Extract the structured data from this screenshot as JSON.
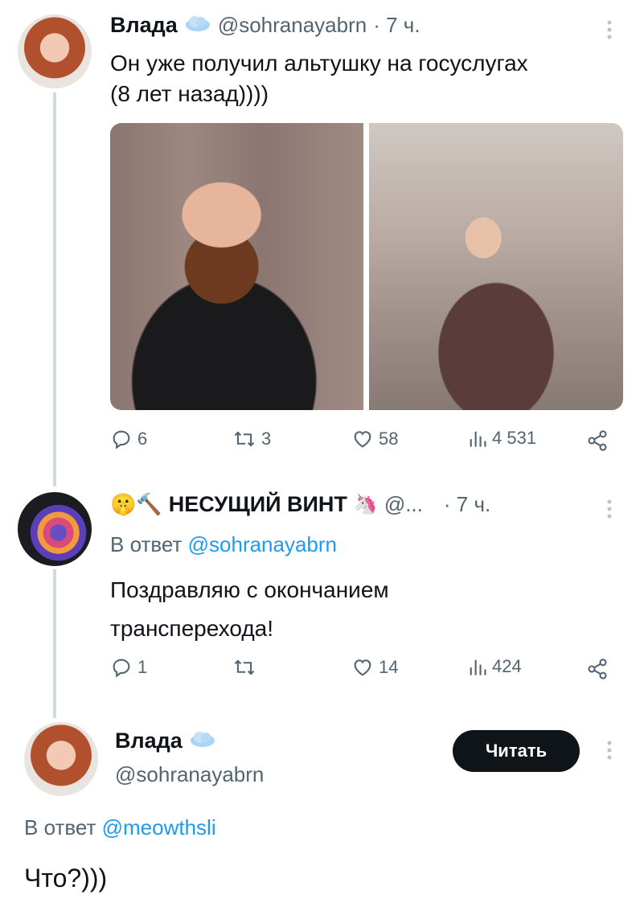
{
  "tweet1": {
    "name": "Влада",
    "handle": "@sohranayabrn",
    "time": "· 7 ч.",
    "text_line1": "Он уже получил альтушку на госуслугах",
    "text_line2": "(8 лет назад))))",
    "actions": {
      "replies": "6",
      "retweets": "3",
      "likes": "58",
      "views": "4 531"
    }
  },
  "tweet2": {
    "name": "НЕСУЩИЙ ВИНТ",
    "name_emoji_prefix": "🤫🔨",
    "name_emoji_suffix": "🦄",
    "handle": "@...",
    "time": "· 7 ч.",
    "reply_prefix": "В ответ",
    "reply_handle": "@sohranayabrn",
    "text_line1": "Поздравляю с окончанием",
    "text_line2": "трансперехода!",
    "actions": {
      "replies": "1",
      "retweets": "",
      "likes": "14",
      "views": "424"
    }
  },
  "tweet3": {
    "name": "Влада",
    "handle": "@sohranayabrn",
    "follow_label": "Читать",
    "reply_prefix": "В ответ",
    "reply_handle": "@meowthsli",
    "text": "Что?)))"
  },
  "icons": {
    "verified": "cloud-badge-icon",
    "more": "more-vertical-icon",
    "reply": "reply-icon",
    "retweet": "retweet-icon",
    "like": "heart-icon",
    "views": "views-icon",
    "share": "share-icon"
  },
  "colors": {
    "link": "#1d9bf0",
    "muted": "#536471",
    "thread": "#cfd9de"
  }
}
